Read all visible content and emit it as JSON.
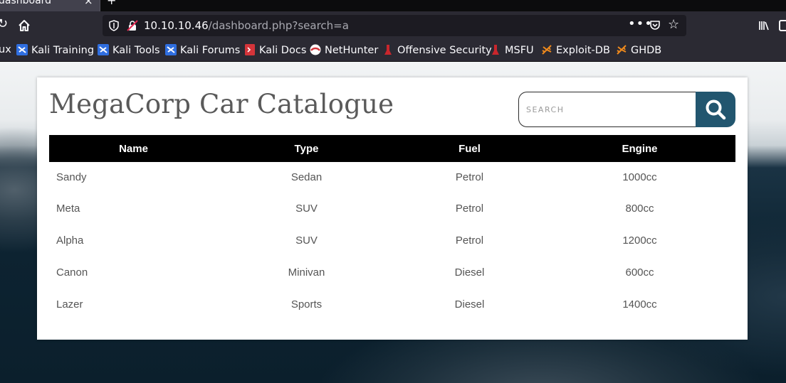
{
  "browser": {
    "tab_title": "dashboard",
    "tab_close": "×",
    "new_tab": "+",
    "url_host": "10.10.10.46",
    "url_path": "/dashboard.php?search=a",
    "url_menu": "•••",
    "bookmarks": [
      {
        "label": "ux",
        "icon": "kali-icon"
      },
      {
        "label": "Kali Training",
        "icon": "kali-icon"
      },
      {
        "label": "Kali Tools",
        "icon": "kali-icon"
      },
      {
        "label": "Kali Forums",
        "icon": "kali-icon"
      },
      {
        "label": "Kali Docs",
        "icon": "kali-docs-icon"
      },
      {
        "label": "NetHunter",
        "icon": "nethunter-icon"
      },
      {
        "label": "Offensive Security",
        "icon": "offsec-icon"
      },
      {
        "label": "MSFU",
        "icon": "offsec-icon"
      },
      {
        "label": "Exploit-DB",
        "icon": "exploitdb-icon"
      },
      {
        "label": "GHDB",
        "icon": "exploitdb-icon"
      }
    ]
  },
  "page": {
    "title": "MegaCorp Car Catalogue",
    "search_placeholder": "SEARCH",
    "search_value": "",
    "accent_color": "#22566f"
  },
  "table": {
    "columns": [
      "Name",
      "Type",
      "Fuel",
      "Engine"
    ],
    "rows": [
      [
        "Sandy",
        "Sedan",
        "Petrol",
        "1000cc"
      ],
      [
        "Meta",
        "SUV",
        "Petrol",
        "800cc"
      ],
      [
        "Alpha",
        "SUV",
        "Petrol",
        "1200cc"
      ],
      [
        "Canon",
        "Minivan",
        "Diesel",
        "600cc"
      ],
      [
        "Lazer",
        "Sports",
        "Diesel",
        "1400cc"
      ]
    ]
  }
}
